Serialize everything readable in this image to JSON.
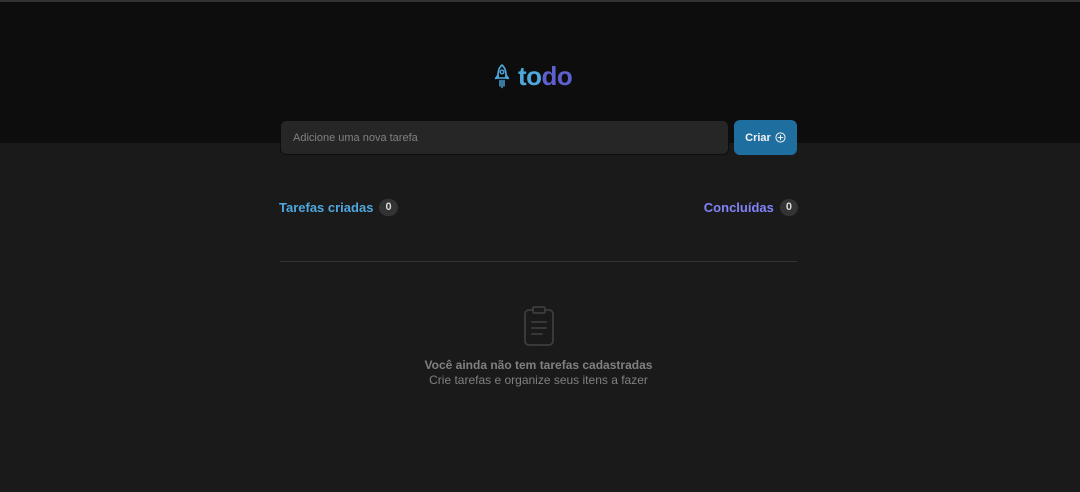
{
  "header": {
    "logo_part1": "to",
    "logo_part2": "do",
    "logo_icon": "rocket-icon",
    "colors": {
      "logo_to": "#4ea8de",
      "logo_do": "#5e60ce",
      "background": "#0d0d0d"
    }
  },
  "form": {
    "input_placeholder": "Adicione uma nova tarefa",
    "input_value": "",
    "create_label": "Criar",
    "create_icon": "plus-circle-icon",
    "button_color": "#1e6f9f"
  },
  "counters": {
    "created_label": "Tarefas criadas",
    "created_count": "0",
    "done_label": "Concluídas",
    "done_count": "0",
    "colors": {
      "created": "#4ea8de",
      "done": "#8284fa"
    }
  },
  "empty_state": {
    "icon": "clipboard-icon",
    "title": "Você ainda não tem tarefas cadastradas",
    "subtitle": "Crie tarefas e organize seus itens a fazer"
  }
}
